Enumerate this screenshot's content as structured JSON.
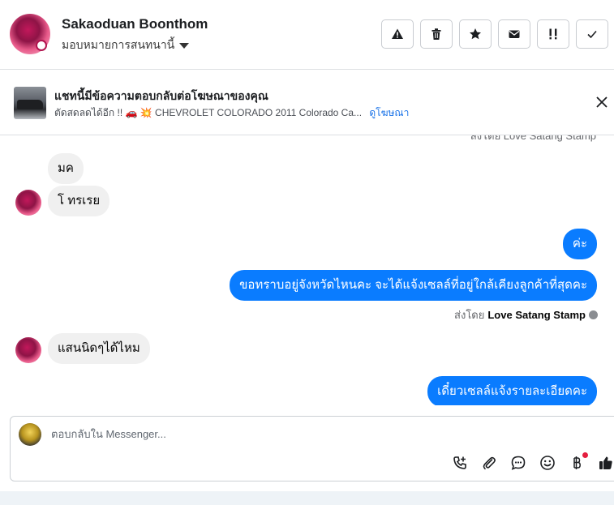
{
  "header": {
    "contact_name": "Sakaoduan Boonthom",
    "assign_label": "มอบหมายการสนทนานี้",
    "actions": [
      {
        "name": "spam-button",
        "icon": "warning-icon"
      },
      {
        "name": "delete-button",
        "icon": "trash-icon"
      },
      {
        "name": "star-button",
        "icon": "star-icon"
      },
      {
        "name": "mark-unread-button",
        "icon": "envelope-icon"
      },
      {
        "name": "follow-up-button",
        "icon": "exclamation-icon"
      },
      {
        "name": "done-button",
        "icon": "check-icon"
      }
    ]
  },
  "ad_banner": {
    "title": "แชทนี้มีข้อความตอบกลับต่อโฆษณาของคุณ",
    "subtitle": "ตัดสดลดได้อีก !! 🚗 💥 CHEVROLET COLORADO 2011 Colorado Ca...",
    "link": "ดูโฆษณา"
  },
  "thread": {
    "truncated_sent_by": "ส่งโดย Love Satang Stamp",
    "messages": [
      {
        "side": "in",
        "text": "มค"
      },
      {
        "side": "in",
        "text": "โ ทรเรย"
      },
      {
        "side": "out",
        "text": "ค่ะ"
      },
      {
        "side": "out",
        "text": "ขอทราบอยู่จังหวัดไหนคะ จะได้แจ้งเซลล์ที่อยู่ใกล้เคียงลูกค้าที่สุดคะ"
      },
      {
        "side": "in",
        "text": "แสนนิดๆได้ไหม"
      },
      {
        "side": "out",
        "text": "เดี๋ยวเซลล์แจ้งรายละเอียดคะ"
      }
    ],
    "sent_by_prefix": "ส่งโดย",
    "sent_by_name": "Love Satang Stamp"
  },
  "composer": {
    "placeholder": "ตอบกลับใน Messenger..."
  },
  "colors": {
    "outgoing_bubble": "#0a7cff",
    "incoming_bubble": "#f0f0f0",
    "link": "#1a73e8"
  }
}
